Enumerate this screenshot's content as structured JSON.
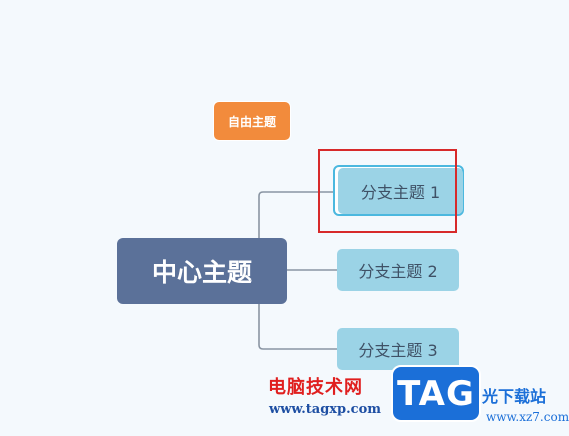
{
  "mindmap": {
    "free_topic": "自由主题",
    "central_topic": "中心主题",
    "branches": [
      {
        "label": "分支主题 1",
        "selected": true
      },
      {
        "label": "分支主题 2",
        "selected": false
      },
      {
        "label": "分支主题 3",
        "selected": false
      }
    ]
  },
  "watermark": {
    "site_name": "电脑技术网",
    "site_url": "www.tagxp.com",
    "logo_text": "TAG",
    "site_name_2": "光下载站",
    "site_url_2": "www.xz7.com"
  },
  "colors": {
    "background": "#f4f9fd",
    "central_topic": "#5b7199",
    "branch": "#9bd3e6",
    "free_topic": "#f28b3c",
    "connector": "#8a95a3",
    "selection": "#d72a2a"
  }
}
